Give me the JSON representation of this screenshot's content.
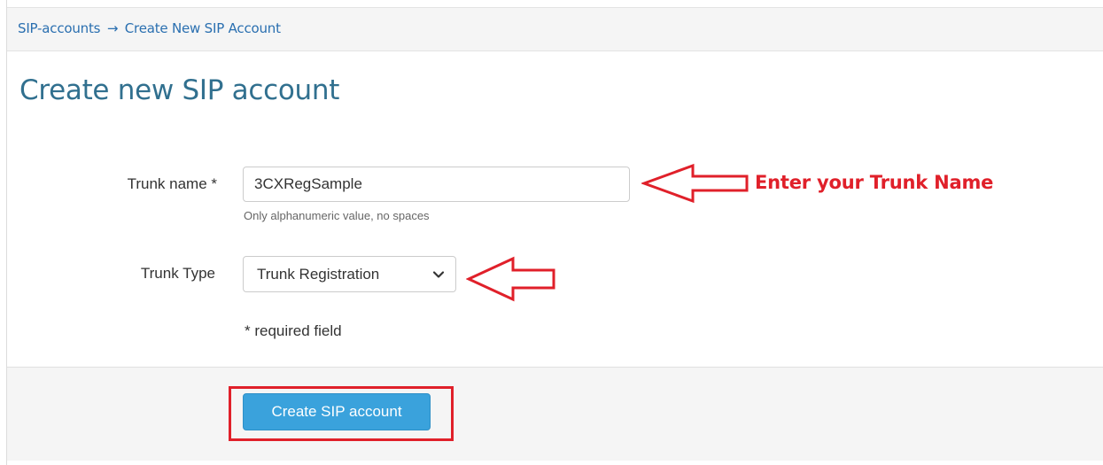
{
  "breadcrumb": {
    "parent": "SIP-accounts",
    "separator": "→",
    "current": "Create New SIP Account"
  },
  "page": {
    "title": "Create new SIP account"
  },
  "form": {
    "trunk_name": {
      "label": "Trunk name *",
      "value": "3CXRegSample",
      "help": "Only alphanumeric value, no spaces"
    },
    "trunk_type": {
      "label": "Trunk Type",
      "selected": "Trunk Registration"
    },
    "required_note": "* required field",
    "submit_label": "Create SIP account"
  },
  "annotations": {
    "trunk_name_hint": "Enter your Trunk Name"
  },
  "colors": {
    "link": "#2a6fb0",
    "title": "#31708f",
    "primary_button": "#3aa2dc",
    "annotation_red": "#e0202a"
  },
  "icons": {
    "select_caret": "chevron-down-icon",
    "annotation_arrow": "left-arrow-icon"
  }
}
